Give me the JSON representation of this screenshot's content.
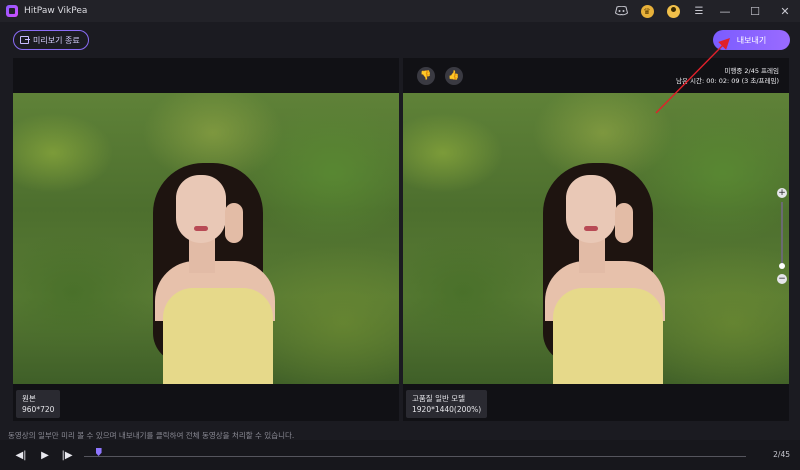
{
  "app": {
    "title": "HitPaw VikPea"
  },
  "titlebar": {
    "icons": [
      "discord-icon",
      "crown-icon",
      "user-avatar-icon",
      "menu-icon"
    ],
    "menu_glyph": "☰",
    "minimize_glyph": "—",
    "maximize_glyph": "☐",
    "close_glyph": "✕"
  },
  "toolbar": {
    "exit_preview_label": "미리보기 종료",
    "export_label": "내보내기"
  },
  "left_pane": {
    "caption": "원본",
    "resolution": "960*720"
  },
  "right_pane": {
    "caption": "고품질 일반 모델",
    "resolution": "1920*1440(200%)",
    "stats_line1": "미행중 2/45 프레임",
    "stats_line2": "남은 시간: 00: 02: 09 (3 초/프레임)",
    "dislike_glyph": "👎",
    "like_glyph": "👍"
  },
  "zoom": {
    "plus": "+",
    "minus": "−"
  },
  "footer": {
    "hint": "동영상의 일부만 미리 볼 수 있으며 내보내기를 클릭하여 전체 동영상을 처리할 수 있습니다.",
    "prev_glyph": "◀|",
    "play_glyph": "▶",
    "next_glyph": "|▶",
    "frame_count": "2/45",
    "progress_fraction": 0.022
  },
  "colors": {
    "accent": "#8a6cf6",
    "annotation_arrow": "#e0202a"
  }
}
